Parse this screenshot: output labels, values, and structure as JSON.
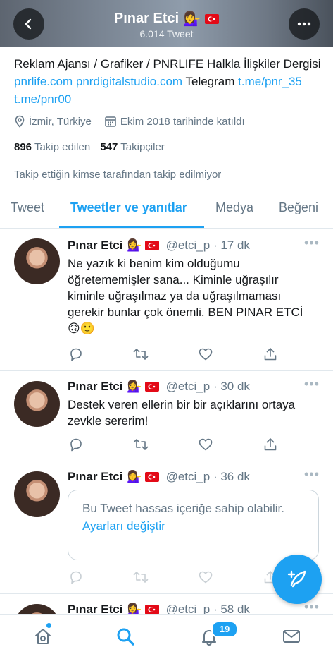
{
  "header": {
    "name": "Pınar Etci",
    "tweet_count": "6.014 Tweet",
    "name_emojis": [
      "woman-tipping-hand-emoji",
      "turkey-flag-emoji"
    ]
  },
  "profile": {
    "bio_text": "Reklam Ajansı / Grafiker / PNRLIFE Halkla İlişkiler Dergisi",
    "bio_link1": "pnrlife.com",
    "bio_link2": "pnrdigitalstudio.com",
    "bio_telegram": "Telegram",
    "bio_link3": "t.me/pnr_35",
    "bio_link4": "t.me/pnr00",
    "location": "İzmir, Türkiye",
    "joined": "Ekim 2018 tarihinde katıldı",
    "following_count": "896",
    "following_label": "Takip edilen",
    "followers_count": "547",
    "followers_label": "Takipçiler",
    "not_followed_text": "Takip ettiğin kimse tarafından takip edilmiyor"
  },
  "tabs": [
    {
      "label": "Tweet",
      "active": false
    },
    {
      "label": "Tweetler ve yanıtlar",
      "active": true
    },
    {
      "label": "Medya",
      "active": false
    },
    {
      "label": "Beğeni",
      "active": false
    }
  ],
  "tweets": [
    {
      "name": "Pınar Etci",
      "handle_time": "@etci_p · 17 dk",
      "text": "Ne yazık ki benim kim olduğumu öğretememişler sana... Kiminle uğraşılır kiminle uğraşılmaz ya da uğraşılmaması gerekir bunlar çok önemli. BEN PINAR ETCİ 🙃🙂"
    },
    {
      "name": "Pınar Etci",
      "handle_time": "@etci_p · 30 dk",
      "text": "Destek veren ellerin bir bir açıklarını ortaya zevkle sererim!"
    },
    {
      "name": "Pınar Etci",
      "handle_time": "@etci_p · 36 dk",
      "sensitive_message": "Bu Tweet hassas içeriğe sahip olabilir.",
      "sensitive_link": "Ayarları değiştir"
    },
    {
      "name": "Pınar Etci",
      "handle_time": "@etci_p · 58 dk"
    }
  ],
  "nav": {
    "notifications_badge": "19"
  },
  "colors": {
    "accent": "#1da1f2",
    "text": "#14171a",
    "muted": "#657786"
  }
}
